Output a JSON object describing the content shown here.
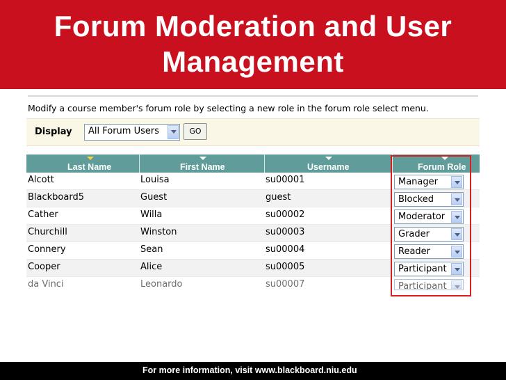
{
  "slide": {
    "title_line1": "Forum Moderation and User",
    "title_line2": "Management",
    "footer": "For more information, visit www.blackboard.niu.edu"
  },
  "instructions": "Modify a course member's forum role by selecting a new role in the forum role select menu.",
  "display": {
    "label": "Display",
    "selected": "All Forum Users",
    "go_label": "GO"
  },
  "table": {
    "columns": [
      "Last Name",
      "First Name",
      "Username",
      "Forum Role"
    ],
    "sorted_column": "Last Name",
    "rows": [
      {
        "last": "Alcott",
        "first": "Louisa",
        "username": "su00001",
        "role": "Manager"
      },
      {
        "last": "Blackboard5",
        "first": "Guest",
        "username": "guest",
        "role": "Blocked"
      },
      {
        "last": "Cather",
        "first": "Willa",
        "username": "su00002",
        "role": "Moderator"
      },
      {
        "last": "Churchill",
        "first": "Winston",
        "username": "su00003",
        "role": "Grader"
      },
      {
        "last": "Connery",
        "first": "Sean",
        "username": "su00004",
        "role": "Reader"
      },
      {
        "last": "Cooper",
        "first": "Alice",
        "username": "su00005",
        "role": "Participant"
      },
      {
        "last": "da Vinci",
        "first": "Leonardo",
        "username": "su00007",
        "role": "Participant"
      }
    ]
  },
  "colors": {
    "title_bg": "#c8101e",
    "header_bg": "#5f9c9a",
    "highlight": "#d81e1e"
  }
}
